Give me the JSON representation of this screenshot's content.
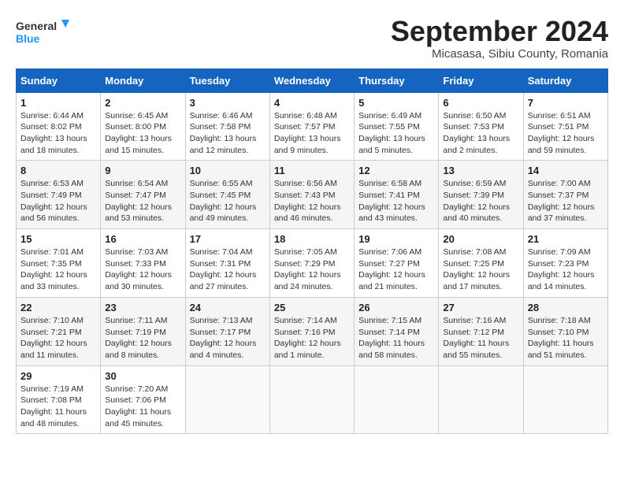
{
  "header": {
    "logo_line1": "General",
    "logo_line2": "Blue",
    "month_title": "September 2024",
    "location": "Micasasa, Sibiu County, Romania"
  },
  "calendar": {
    "days_of_week": [
      "Sunday",
      "Monday",
      "Tuesday",
      "Wednesday",
      "Thursday",
      "Friday",
      "Saturday"
    ],
    "weeks": [
      [
        {
          "day": "1",
          "info": "Sunrise: 6:44 AM\nSunset: 8:02 PM\nDaylight: 13 hours and 18 minutes."
        },
        {
          "day": "2",
          "info": "Sunrise: 6:45 AM\nSunset: 8:00 PM\nDaylight: 13 hours and 15 minutes."
        },
        {
          "day": "3",
          "info": "Sunrise: 6:46 AM\nSunset: 7:58 PM\nDaylight: 13 hours and 12 minutes."
        },
        {
          "day": "4",
          "info": "Sunrise: 6:48 AM\nSunset: 7:57 PM\nDaylight: 13 hours and 9 minutes."
        },
        {
          "day": "5",
          "info": "Sunrise: 6:49 AM\nSunset: 7:55 PM\nDaylight: 13 hours and 5 minutes."
        },
        {
          "day": "6",
          "info": "Sunrise: 6:50 AM\nSunset: 7:53 PM\nDaylight: 13 hours and 2 minutes."
        },
        {
          "day": "7",
          "info": "Sunrise: 6:51 AM\nSunset: 7:51 PM\nDaylight: 12 hours and 59 minutes."
        }
      ],
      [
        {
          "day": "8",
          "info": "Sunrise: 6:53 AM\nSunset: 7:49 PM\nDaylight: 12 hours and 56 minutes."
        },
        {
          "day": "9",
          "info": "Sunrise: 6:54 AM\nSunset: 7:47 PM\nDaylight: 12 hours and 53 minutes."
        },
        {
          "day": "10",
          "info": "Sunrise: 6:55 AM\nSunset: 7:45 PM\nDaylight: 12 hours and 49 minutes."
        },
        {
          "day": "11",
          "info": "Sunrise: 6:56 AM\nSunset: 7:43 PM\nDaylight: 12 hours and 46 minutes."
        },
        {
          "day": "12",
          "info": "Sunrise: 6:58 AM\nSunset: 7:41 PM\nDaylight: 12 hours and 43 minutes."
        },
        {
          "day": "13",
          "info": "Sunrise: 6:59 AM\nSunset: 7:39 PM\nDaylight: 12 hours and 40 minutes."
        },
        {
          "day": "14",
          "info": "Sunrise: 7:00 AM\nSunset: 7:37 PM\nDaylight: 12 hours and 37 minutes."
        }
      ],
      [
        {
          "day": "15",
          "info": "Sunrise: 7:01 AM\nSunset: 7:35 PM\nDaylight: 12 hours and 33 minutes."
        },
        {
          "day": "16",
          "info": "Sunrise: 7:03 AM\nSunset: 7:33 PM\nDaylight: 12 hours and 30 minutes."
        },
        {
          "day": "17",
          "info": "Sunrise: 7:04 AM\nSunset: 7:31 PM\nDaylight: 12 hours and 27 minutes."
        },
        {
          "day": "18",
          "info": "Sunrise: 7:05 AM\nSunset: 7:29 PM\nDaylight: 12 hours and 24 minutes."
        },
        {
          "day": "19",
          "info": "Sunrise: 7:06 AM\nSunset: 7:27 PM\nDaylight: 12 hours and 21 minutes."
        },
        {
          "day": "20",
          "info": "Sunrise: 7:08 AM\nSunset: 7:25 PM\nDaylight: 12 hours and 17 minutes."
        },
        {
          "day": "21",
          "info": "Sunrise: 7:09 AM\nSunset: 7:23 PM\nDaylight: 12 hours and 14 minutes."
        }
      ],
      [
        {
          "day": "22",
          "info": "Sunrise: 7:10 AM\nSunset: 7:21 PM\nDaylight: 12 hours and 11 minutes."
        },
        {
          "day": "23",
          "info": "Sunrise: 7:11 AM\nSunset: 7:19 PM\nDaylight: 12 hours and 8 minutes."
        },
        {
          "day": "24",
          "info": "Sunrise: 7:13 AM\nSunset: 7:17 PM\nDaylight: 12 hours and 4 minutes."
        },
        {
          "day": "25",
          "info": "Sunrise: 7:14 AM\nSunset: 7:16 PM\nDaylight: 12 hours and 1 minute."
        },
        {
          "day": "26",
          "info": "Sunrise: 7:15 AM\nSunset: 7:14 PM\nDaylight: 11 hours and 58 minutes."
        },
        {
          "day": "27",
          "info": "Sunrise: 7:16 AM\nSunset: 7:12 PM\nDaylight: 11 hours and 55 minutes."
        },
        {
          "day": "28",
          "info": "Sunrise: 7:18 AM\nSunset: 7:10 PM\nDaylight: 11 hours and 51 minutes."
        }
      ],
      [
        {
          "day": "29",
          "info": "Sunrise: 7:19 AM\nSunset: 7:08 PM\nDaylight: 11 hours and 48 minutes."
        },
        {
          "day": "30",
          "info": "Sunrise: 7:20 AM\nSunset: 7:06 PM\nDaylight: 11 hours and 45 minutes."
        },
        {
          "day": "",
          "info": ""
        },
        {
          "day": "",
          "info": ""
        },
        {
          "day": "",
          "info": ""
        },
        {
          "day": "",
          "info": ""
        },
        {
          "day": "",
          "info": ""
        }
      ]
    ]
  }
}
